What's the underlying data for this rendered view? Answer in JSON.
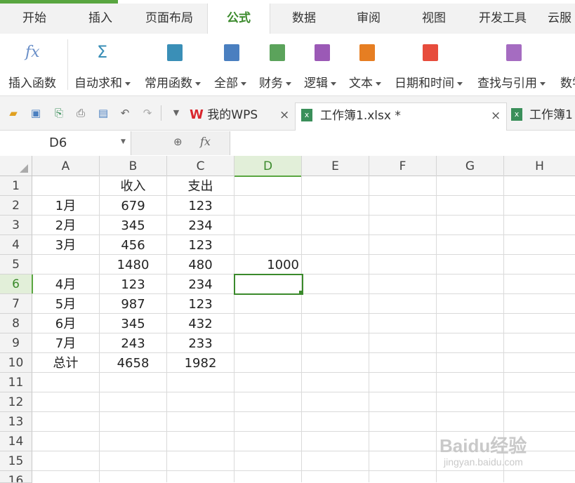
{
  "menu_tabs": [
    "开始",
    "插入",
    "页面布局",
    "公式",
    "数据",
    "审阅",
    "视图",
    "开发工具",
    "云服"
  ],
  "ribbon": {
    "insert_function": "插入函数",
    "fx_glyph": "fx",
    "sigma_glyph": "Σ",
    "buttons": [
      "自动求和",
      "常用函数",
      "全部",
      "财务",
      "逻辑",
      "文本",
      "日期和时间",
      "查找与引用",
      "数学"
    ]
  },
  "doc_tabs": {
    "my_wps": "我的WPS",
    "active": "工作簿1.xlsx *",
    "other": "工作簿1"
  },
  "formula_bar": {
    "name_box": "D6",
    "fx_label": "fx",
    "content": ""
  },
  "columns": [
    "A",
    "B",
    "C",
    "D",
    "E",
    "F",
    "G",
    "H"
  ],
  "rows": [
    "1",
    "2",
    "3",
    "4",
    "5",
    "6",
    "7",
    "8",
    "9",
    "10",
    "11",
    "12",
    "13",
    "14",
    "15",
    "16"
  ],
  "cells": {
    "B1": "收入",
    "C1": "支出",
    "A2": "1月",
    "B2": "679",
    "C2": "123",
    "A3": "2月",
    "B3": "345",
    "C3": "234",
    "A4": "3月",
    "B4": "456",
    "C4": "123",
    "B5": "1480",
    "C5": "480",
    "D5": "1000",
    "A6": "4月",
    "B6": "123",
    "C6": "234",
    "A7": "5月",
    "B7": "987",
    "C7": "123",
    "A8": "6月",
    "B8": "345",
    "C8": "432",
    "A9": "7月",
    "B9": "243",
    "C9": "233",
    "A10": "总计",
    "B10": "4658",
    "C10": "1982"
  },
  "watermark": {
    "main": "Baidu经验",
    "sub": "jingyan.baidu.com"
  },
  "colors": {
    "accent": "#59a640",
    "ribbon_icons": [
      "#3a8fb7",
      "#4a7fc0",
      "#5ba35b",
      "#9b59b6",
      "#e67e22",
      "#e74c3c",
      "#a56cc1"
    ]
  }
}
